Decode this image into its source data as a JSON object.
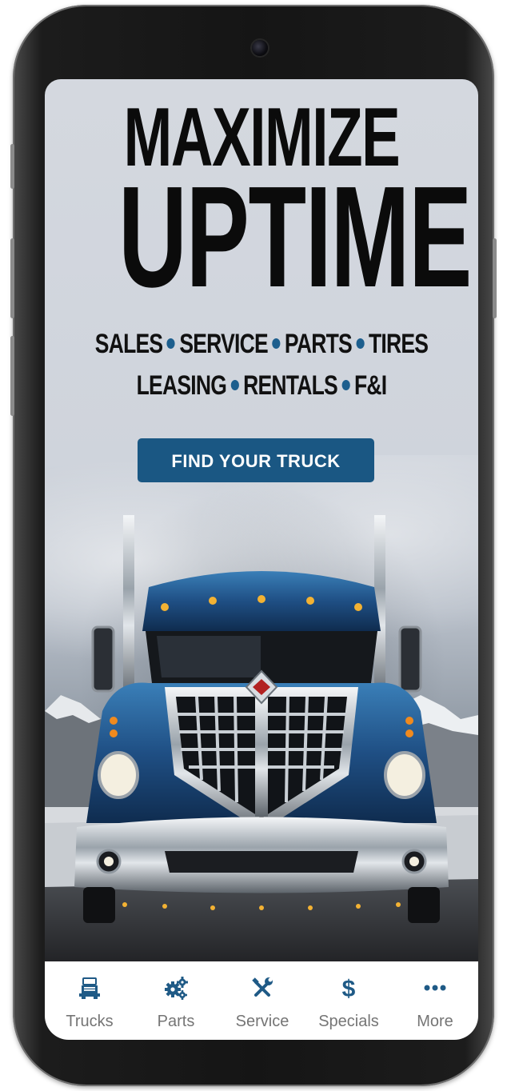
{
  "hero": {
    "headline_line1": "MAXIMIZE",
    "headline_line2": "UPTIME",
    "services_row1": [
      "SALES",
      "SERVICE",
      "PARTS",
      "TIRES"
    ],
    "services_row2": [
      "LEASING",
      "RENTALS",
      "F&I"
    ],
    "cta_label": "FIND YOUR TRUCK"
  },
  "tabs": [
    {
      "label": "Trucks",
      "icon": "truck-icon"
    },
    {
      "label": "Parts",
      "icon": "gears-icon"
    },
    {
      "label": "Service",
      "icon": "tools-icon"
    },
    {
      "label": "Specials",
      "icon": "dollar-icon"
    },
    {
      "label": "More",
      "icon": "more-icon"
    }
  ],
  "colors": {
    "accent": "#1A5783",
    "dot": "#1D5F8E",
    "tab_icon": "#1F5A86",
    "tab_label": "#757575",
    "headline": "#0B0B0B"
  }
}
